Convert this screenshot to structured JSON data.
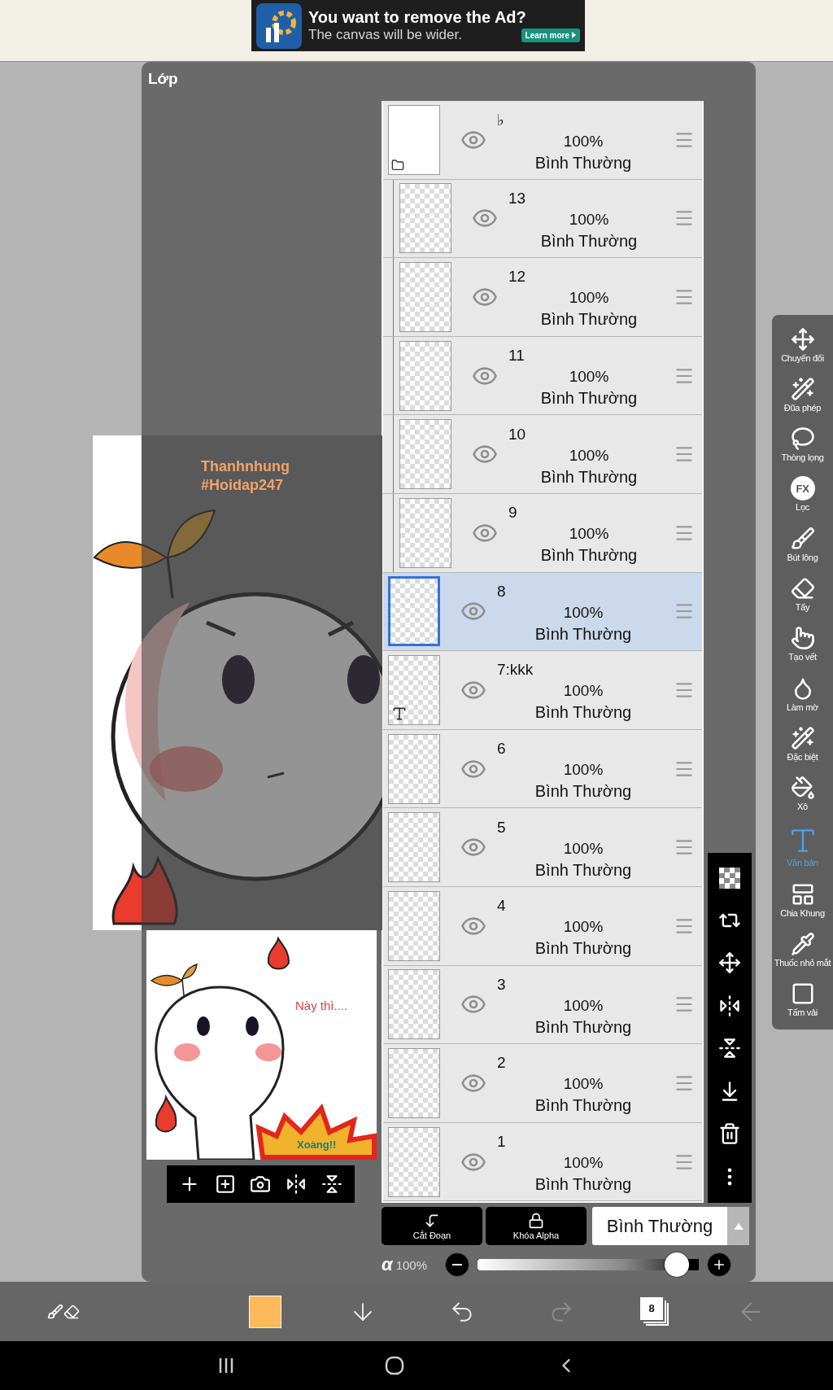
{
  "ad": {
    "title": "You want to remove the Ad?",
    "subtitle": "The canvas will be wider.",
    "button": "Learn more"
  },
  "panel_title": "Lớp",
  "canvas": {
    "texts": [
      "Thanhnhung",
      "#Hoidap247"
    ]
  },
  "preview": {
    "texts": [
      "Này thì....",
      "Xoảng!!"
    ]
  },
  "layers": [
    {
      "name": "♭",
      "kind": "folder",
      "opacity": "100%",
      "blend": "Bình Thường",
      "visible": true,
      "selected": false,
      "children": [
        {
          "name": "13",
          "kind": "raster",
          "opacity": "100%",
          "blend": "Bình Thường",
          "visible": true,
          "selected": false
        },
        {
          "name": "12",
          "kind": "raster",
          "opacity": "100%",
          "blend": "Bình Thường",
          "visible": true,
          "selected": false
        },
        {
          "name": "11",
          "kind": "raster",
          "opacity": "100%",
          "blend": "Bình Thường",
          "visible": true,
          "selected": false
        },
        {
          "name": "10",
          "kind": "raster",
          "opacity": "100%",
          "blend": "Bình Thường",
          "visible": true,
          "selected": false
        },
        {
          "name": "9",
          "kind": "raster",
          "opacity": "100%",
          "blend": "Bình Thường",
          "visible": true,
          "selected": false
        }
      ]
    },
    {
      "name": "8",
      "kind": "raster",
      "opacity": "100%",
      "blend": "Bình Thường",
      "visible": true,
      "selected": true
    },
    {
      "name": "7:kkk",
      "kind": "text",
      "opacity": "100%",
      "blend": "Bình Thường",
      "visible": true,
      "selected": false
    },
    {
      "name": "6",
      "kind": "raster",
      "opacity": "100%",
      "blend": "Bình Thường",
      "visible": true,
      "selected": false
    },
    {
      "name": "5",
      "kind": "raster",
      "opacity": "100%",
      "blend": "Bình Thường",
      "visible": true,
      "selected": false
    },
    {
      "name": "4",
      "kind": "raster",
      "opacity": "100%",
      "blend": "Bình Thường",
      "visible": true,
      "selected": false
    },
    {
      "name": "3",
      "kind": "raster",
      "opacity": "100%",
      "blend": "Bình Thường",
      "visible": true,
      "selected": false
    },
    {
      "name": "2",
      "kind": "raster",
      "opacity": "100%",
      "blend": "Bình Thường",
      "visible": true,
      "selected": false
    },
    {
      "name": "1",
      "kind": "raster",
      "opacity": "100%",
      "blend": "Bình Thường",
      "visible": true,
      "selected": false
    }
  ],
  "layer_actions": {
    "clipping": "Cắt Đoạn",
    "alpha_lock": "Khóa Alpha",
    "blend_mode": "Bình Thường"
  },
  "opacity": {
    "symbol": "α",
    "reading": "100%",
    "level": 0.95
  },
  "tools": [
    {
      "label": "Chuyển đổi",
      "selected": false
    },
    {
      "label": "Đũa phép",
      "selected": false
    },
    {
      "label": "Thòng lọng",
      "selected": false
    },
    {
      "label": "Lọc",
      "badge": "FX",
      "selected": false
    },
    {
      "label": "Bút lông",
      "selected": false
    },
    {
      "label": "Tẩy",
      "selected": false
    },
    {
      "label": "Tạo vết",
      "selected": false
    },
    {
      "label": "Làm mờ",
      "selected": false
    },
    {
      "label": "Đặc biệt",
      "selected": false
    },
    {
      "label": "Xô",
      "selected": false
    },
    {
      "label": "Văn bản",
      "selected": true
    },
    {
      "label": "Chia Khung",
      "selected": false
    },
    {
      "label": "Thuốc nhỏ mắt",
      "selected": false
    },
    {
      "label": "Tấm vải",
      "selected": false
    }
  ],
  "bottom_bar": {
    "color": "#fdb95b",
    "layer_count": "8",
    "redo_disabled": true
  }
}
